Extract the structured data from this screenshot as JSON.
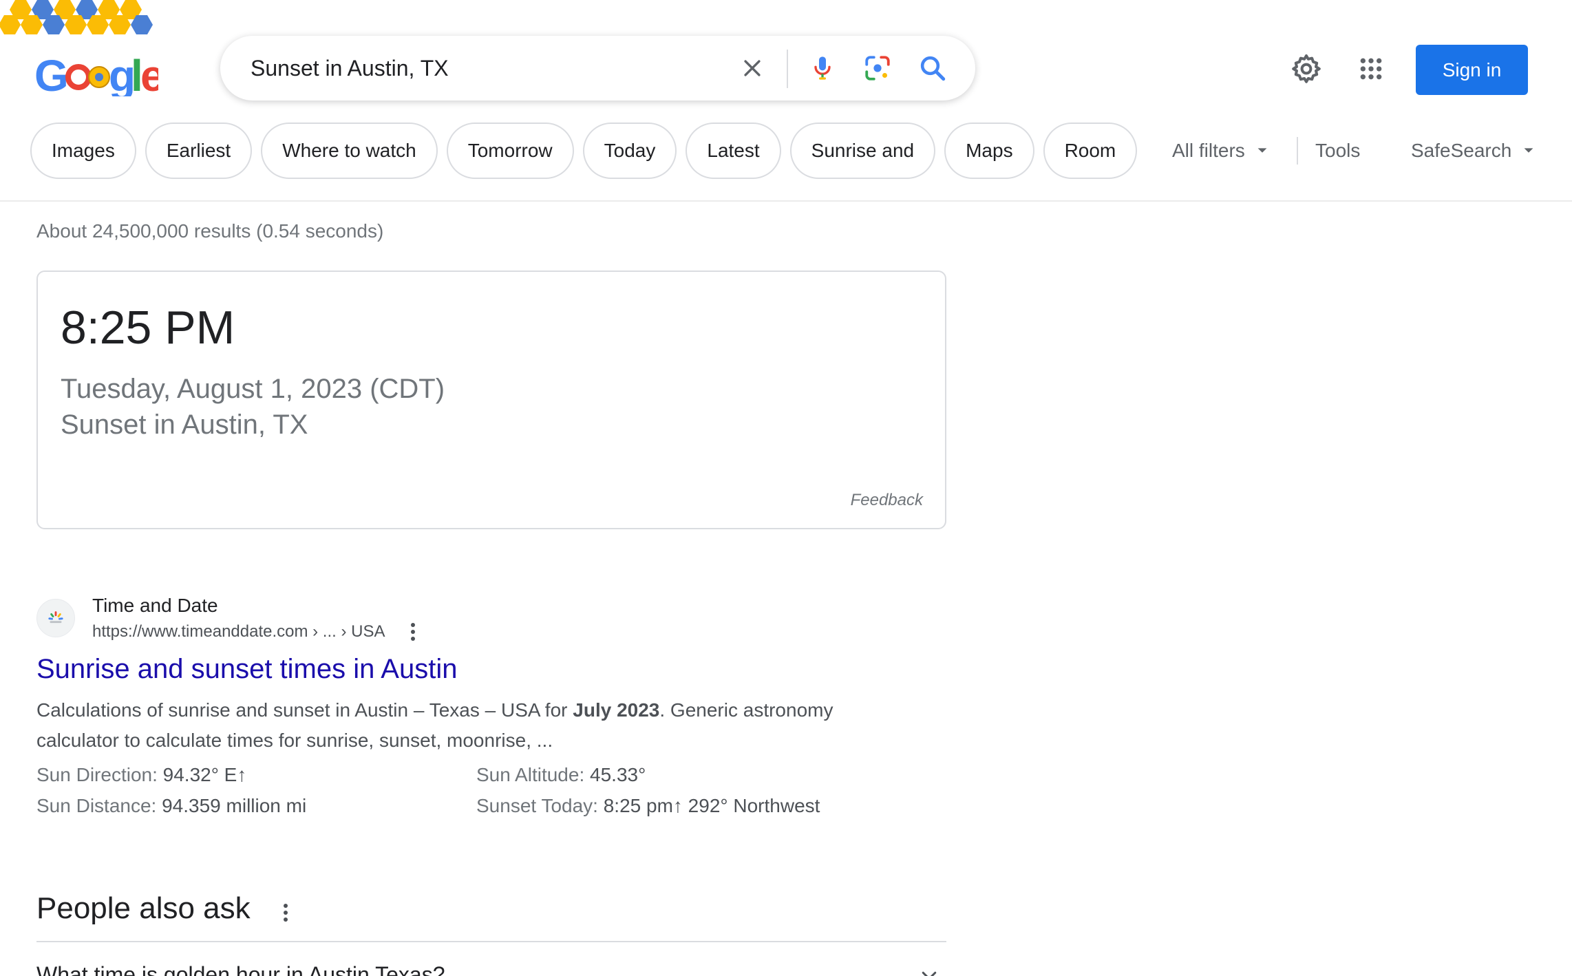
{
  "search": {
    "query": "Sunset in Austin, TX"
  },
  "header": {
    "sign_in_label": "Sign in"
  },
  "filters": {
    "chips": [
      "Images",
      "Earliest",
      "Where to watch",
      "Tomorrow",
      "Today",
      "Latest",
      "Sunrise and",
      "Maps",
      "Room"
    ],
    "all_filters_label": "All filters",
    "tools_label": "Tools",
    "safesearch_label": "SafeSearch"
  },
  "results": {
    "stats": "About 24,500,000 results (0.54 seconds)",
    "answer": {
      "time": "8:25 PM",
      "date": "Tuesday, August 1, 2023 (CDT)",
      "place": "Sunset in Austin, TX",
      "feedback_label": "Feedback"
    },
    "organic": {
      "site_name": "Time and Date",
      "url": "https://www.timeanddate.com › ... › USA",
      "title": "Sunrise and sunset times in Austin",
      "snippet_part1": "Calculations of sunrise and sunset in Austin – Texas – USA for ",
      "snippet_bold": "July 2023",
      "snippet_part2": ". Generic astronomy calculator to calculate times for sunrise, sunset, moonrise, ...",
      "facts": [
        {
          "label": "Sun Direction: ",
          "value": "94.32° E↑"
        },
        {
          "label": "Sun Altitude: ",
          "value": "45.33°"
        },
        {
          "label": "Sun Distance: ",
          "value": "94.359 million mi"
        },
        {
          "label": "Sunset Today: ",
          "value": "8:25 pm↑ 292° Northwest"
        }
      ]
    },
    "people_also_ask": {
      "title": "People also ask",
      "questions": [
        "What time is golden hour in Austin Texas?"
      ]
    }
  },
  "colors": {
    "brand_blue": "#1a73e8",
    "link_blue": "#1a0dab",
    "logo_blue": "#4285f4",
    "logo_red": "#ea4335",
    "logo_yellow": "#fbbc05",
    "logo_green": "#34a853"
  },
  "icons": {
    "clear": "close-icon",
    "voice": "microphone-icon",
    "lens": "camera-lens-icon",
    "search": "search-icon",
    "settings": "gear-icon",
    "apps": "apps-grid-icon",
    "dropdown": "caret-down-icon",
    "more": "more-vert-icon",
    "expand": "chevron-down-icon"
  }
}
